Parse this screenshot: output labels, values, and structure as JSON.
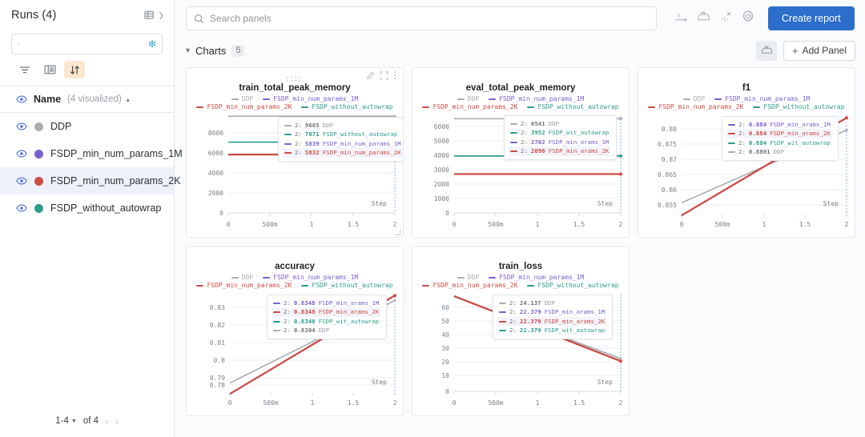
{
  "sidebar": {
    "title": "Runs (4)",
    "header_icon": "table-columns-icon",
    "search": {
      "value": "",
      "placeholder": "",
      "icon": "search-icon",
      "magic_icon": "magic-wand-icon"
    },
    "tools": [
      {
        "name": "filter-icon",
        "label": "Filter",
        "active": false
      },
      {
        "name": "columns-icon",
        "label": "Columns",
        "active": false
      },
      {
        "name": "sort-icon",
        "label": "Sort",
        "active": true
      }
    ],
    "name_header": {
      "label": "Name",
      "sub": "(4 visualized)",
      "sort_caret": "▴"
    },
    "runs": [
      {
        "name": "DDP",
        "color": "#a9aeb4",
        "selected": false
      },
      {
        "name": "FSDP_min_num_params_1M",
        "color": "#7b5ed0",
        "selected": false
      },
      {
        "name": "FSDP_min_num_params_2K",
        "color": "#cf4a45",
        "selected": true
      },
      {
        "name": "FSDP_without_autowrap",
        "color": "#2d9c8c",
        "selected": false
      }
    ],
    "pager": {
      "range": "1-4",
      "of": "of 4",
      "prev": "‹",
      "next": "›"
    }
  },
  "toolbar": {
    "search": {
      "value": "",
      "placeholder": "Search panels",
      "icon": "search-icon"
    },
    "icons": [
      {
        "name": "x-axis-icon"
      },
      {
        "name": "smoothing-icon"
      },
      {
        "name": "outliers-icon"
      },
      {
        "name": "gear-icon"
      }
    ],
    "create_report_label": "Create report"
  },
  "section": {
    "chevron": "⌄",
    "title": "Charts",
    "count": "5",
    "iron_icon": "smoothing-icon",
    "add_panel_label": "Add Panel",
    "add_panel_plus": "+"
  },
  "series_colors": {
    "DDP": "#a9aeb4",
    "FSDP_min_num_params_1M": "#7b5ed0",
    "FSDP_min_num_params_2K": "#cf4a45",
    "FSDP_without_autowrap": "#2d9c8c"
  },
  "legend_labels": [
    "DDP",
    "FSDP_min_num_params_1M",
    "FSDP_min_num_params_2K",
    "FSDP_without_autowrap"
  ],
  "panel_actions": {
    "drag": "drag-handle-icon",
    "edit": "pencil-icon",
    "expand": "fullscreen-icon",
    "more": "more-vertical-icon"
  },
  "chart_data": [
    {
      "type": "line",
      "title": "train_total_peak_memory",
      "xlabel": "Step",
      "ylabel": "",
      "x": [
        0,
        1,
        2
      ],
      "xticks": [
        "0",
        "500m",
        "1",
        "1.5",
        "2"
      ],
      "xlim": [
        0,
        2
      ],
      "yticks": [
        "0",
        "2000",
        "4000",
        "6000",
        "8000"
      ],
      "ylim": [
        0,
        10200
      ],
      "grid": true,
      "legend_position": "top",
      "series": [
        {
          "name": "DDP",
          "values": [
            9665,
            9665,
            9665
          ]
        },
        {
          "name": "FSDP_without_autowrap",
          "values": [
            7071,
            7071,
            7071
          ]
        },
        {
          "name": "FSDP_min_num_params_1M",
          "values": [
            5839,
            5839,
            5839
          ]
        },
        {
          "name": "FSDP_min_num_params_2K",
          "values": [
            5832,
            5832,
            5832
          ]
        }
      ],
      "tooltip": [
        {
          "step": "2:",
          "value": "9665",
          "name": "DDP",
          "highlight": false
        },
        {
          "step": "2:",
          "value": "7071",
          "name": "FSDP_without_autowrap",
          "highlight": false
        },
        {
          "step": "2:",
          "value": "5839",
          "name": "FSDP_min_num_params_1M",
          "highlight": false
        },
        {
          "step": "2:",
          "value": "5832",
          "name": "FSDP_min_num_params_2K",
          "highlight": true
        }
      ]
    },
    {
      "type": "line",
      "title": "eval_total_peak_memory",
      "xlabel": "Step",
      "ylabel": "",
      "x": [
        0,
        1,
        2
      ],
      "xticks": [
        "0",
        "500m",
        "1",
        "1.5",
        "2"
      ],
      "xlim": [
        0,
        2
      ],
      "yticks": [
        "0",
        "1000",
        "2000",
        "3000",
        "4000",
        "5000",
        "6000"
      ],
      "ylim": [
        0,
        6800
      ],
      "grid": true,
      "legend_position": "top",
      "series": [
        {
          "name": "DDP",
          "values": [
            6541,
            6541,
            6541
          ]
        },
        {
          "name": "FSDP_without_autowrap",
          "values": [
            3952,
            3952,
            3952
          ]
        },
        {
          "name": "FSDP_min_num_params_1M",
          "values": [
            2702,
            2702,
            2702
          ]
        },
        {
          "name": "FSDP_min_num_params_2K",
          "values": [
            2696,
            2696,
            2696
          ]
        }
      ],
      "tooltip": [
        {
          "step": "2:",
          "value": "6541",
          "name": "DDP",
          "highlight": false
        },
        {
          "step": "2:",
          "value": "3952",
          "name": "FSDP_wit_autowrap",
          "highlight": false
        },
        {
          "step": "2:",
          "value": "2702",
          "name": "FSDP_min_arams_1M",
          "highlight": false
        },
        {
          "step": "2:",
          "value": "2696",
          "name": "FSDP_min_arams_2K",
          "highlight": true
        }
      ]
    },
    {
      "type": "line",
      "title": "f1",
      "xlabel": "Step",
      "ylabel": "",
      "x": [
        0,
        2
      ],
      "xticks": [
        "0",
        "500m",
        "1",
        "1.5",
        "2"
      ],
      "xlim": [
        0,
        2
      ],
      "yticks": [
        "0.855",
        "0.86",
        "0.865",
        "0.87",
        "0.875",
        "0.88"
      ],
      "ylim": [
        0.8505,
        0.8845
      ],
      "grid": true,
      "legend_position": "top",
      "series": [
        {
          "name": "DDP",
          "values": [
            0.8562,
            0.8801
          ]
        },
        {
          "name": "FSDP_min_num_params_1M",
          "values": [
            0.8521,
            0.884
          ]
        },
        {
          "name": "FSDP_min_num_params_2K",
          "values": [
            0.8521,
            0.884
          ]
        },
        {
          "name": "FSDP_without_autowrap",
          "values": [
            0.8521,
            0.884
          ]
        }
      ],
      "tooltip": [
        {
          "step": "2:",
          "value": "0.884",
          "name": "FSDP_min_arams_1M",
          "highlight": false
        },
        {
          "step": "2:",
          "value": "0.884",
          "name": "FSDP_min_arams_2K",
          "highlight": true
        },
        {
          "step": "2:",
          "value": "0.884",
          "name": "FSDP_wit_autowrap",
          "highlight": false
        },
        {
          "step": "2:",
          "value": "0.8801",
          "name": "DDP",
          "highlight": false
        }
      ]
    },
    {
      "type": "line",
      "title": "accuracy",
      "xlabel": "Step",
      "ylabel": "",
      "x": [
        0,
        2
      ],
      "xticks": [
        "0",
        "500m",
        "1",
        "1.5",
        "2"
      ],
      "xlim": [
        0,
        2
      ],
      "yticks": [
        "0.78",
        "0.79",
        "0.8",
        "0.81",
        "0.82",
        "0.83"
      ],
      "ylim": [
        0.7735,
        0.8355
      ],
      "grid": true,
      "legend_position": "top",
      "series": [
        {
          "name": "DDP",
          "values": [
            0.7812,
            0.8304
          ]
        },
        {
          "name": "FSDP_min_num_params_1M",
          "values": [
            0.7752,
            0.8348
          ]
        },
        {
          "name": "FSDP_min_num_params_2K",
          "values": [
            0.7752,
            0.8348
          ]
        },
        {
          "name": "FSDP_without_autowrap",
          "values": [
            0.7752,
            0.8348
          ]
        }
      ],
      "tooltip": [
        {
          "step": "2:",
          "value": "0.8348",
          "name": "FSDP_min_arams_1M",
          "highlight": false
        },
        {
          "step": "2:",
          "value": "0.8348",
          "name": "FSDP_min_arams_2K",
          "highlight": true
        },
        {
          "step": "2:",
          "value": "0.8348",
          "name": "FSDP_wit_autowrap",
          "highlight": false
        },
        {
          "step": "2:",
          "value": "0.8304",
          "name": "DDP",
          "highlight": false
        }
      ]
    },
    {
      "type": "line",
      "title": "train_loss",
      "xlabel": "Step",
      "ylabel": "",
      "x": [
        0,
        2
      ],
      "xticks": [
        "0",
        "500m",
        "1",
        "1.5",
        "2"
      ],
      "xlim": [
        0,
        2
      ],
      "yticks": [
        "0",
        "10",
        "20",
        "30",
        "40",
        "50",
        "60"
      ],
      "ylim": [
        0,
        70
      ],
      "grid": true,
      "legend_position": "top",
      "series": [
        {
          "name": "DDP",
          "values": [
            67.5,
            24.137
          ]
        },
        {
          "name": "FSDP_min_num_params_1M",
          "values": [
            67.8,
            22.379
          ]
        },
        {
          "name": "FSDP_min_num_params_2K",
          "values": [
            67.8,
            22.379
          ]
        },
        {
          "name": "FSDP_without_autowrap",
          "values": [
            67.8,
            22.379
          ]
        }
      ],
      "tooltip": [
        {
          "step": "2:",
          "value": "24.137",
          "name": "DDP",
          "highlight": false
        },
        {
          "step": "2:",
          "value": "22.379",
          "name": "FSDP_min_arams_1M",
          "highlight": false
        },
        {
          "step": "2:",
          "value": "22.379",
          "name": "FSDP_min_arams_2K",
          "highlight": true
        },
        {
          "step": "2:",
          "value": "22.379",
          "name": "FSDP_wit_autowrap",
          "highlight": false
        }
      ]
    }
  ]
}
